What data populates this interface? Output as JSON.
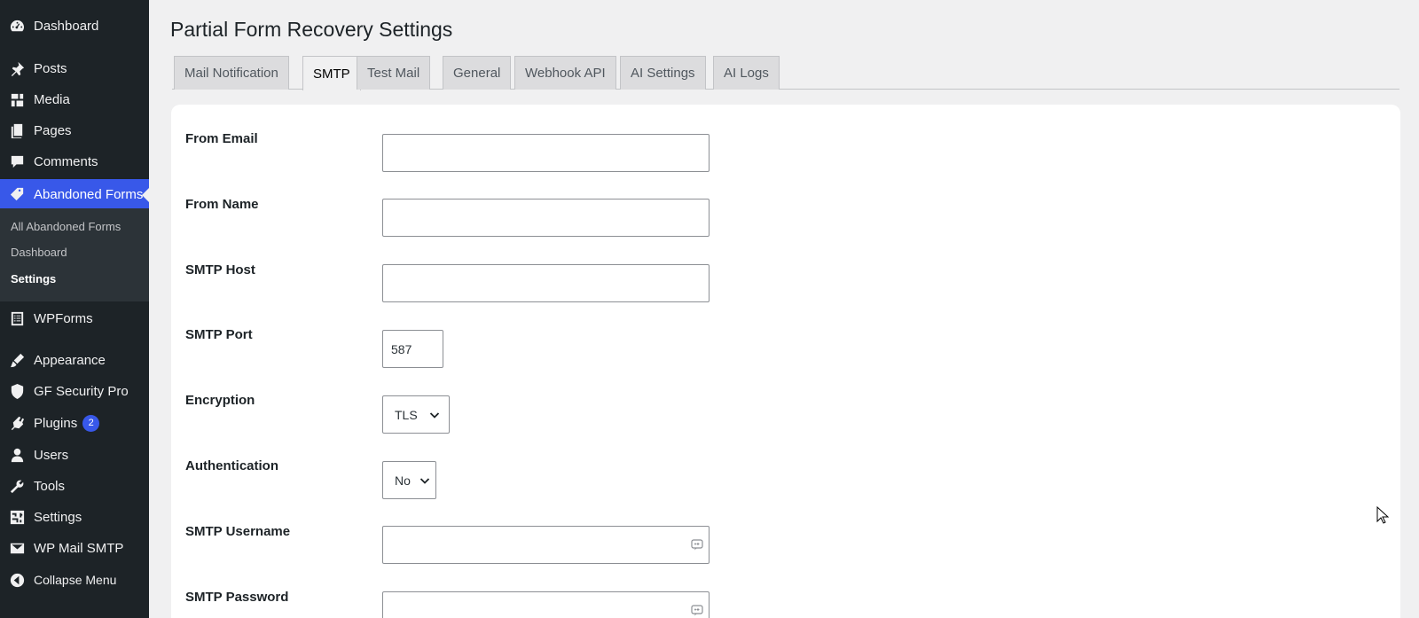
{
  "sidebar": {
    "items": [
      {
        "label": "Dashboard",
        "icon": "dashboard-icon"
      },
      {
        "label": "Posts",
        "icon": "pin-icon"
      },
      {
        "label": "Media",
        "icon": "media-icon"
      },
      {
        "label": "Pages",
        "icon": "pages-icon"
      },
      {
        "label": "Comments",
        "icon": "comment-icon"
      },
      {
        "label": "Abandoned Forms",
        "icon": "tag-icon"
      },
      {
        "label": "WPForms",
        "icon": "forms-icon"
      },
      {
        "label": "Appearance",
        "icon": "brush-icon"
      },
      {
        "label": "GF Security Pro",
        "icon": "shield-icon"
      },
      {
        "label": "Plugins",
        "icon": "plugin-icon",
        "badge": "2"
      },
      {
        "label": "Users",
        "icon": "user-icon"
      },
      {
        "label": "Tools",
        "icon": "wrench-icon"
      },
      {
        "label": "Settings",
        "icon": "settings-icon"
      },
      {
        "label": "WP Mail SMTP",
        "icon": "mail-icon"
      },
      {
        "label": "Collapse Menu",
        "icon": "collapse-icon"
      }
    ],
    "submenu": [
      {
        "label": "All Abandoned Forms"
      },
      {
        "label": "Dashboard"
      },
      {
        "label": "Settings"
      }
    ],
    "active_color": "#3858e9"
  },
  "page": {
    "title": "Partial Form Recovery Settings"
  },
  "tabs": [
    {
      "label": "Mail Notification"
    },
    {
      "label": "SMTP"
    },
    {
      "label": "Test Mail"
    },
    {
      "label": "General"
    },
    {
      "label": "Webhook API"
    },
    {
      "label": "AI Settings"
    },
    {
      "label": "AI Logs"
    }
  ],
  "form": {
    "from_email": {
      "label": "From Email",
      "value": ""
    },
    "from_name": {
      "label": "From Name",
      "value": ""
    },
    "smtp_host": {
      "label": "SMTP Host",
      "value": ""
    },
    "smtp_port": {
      "label": "SMTP Port",
      "value": "587"
    },
    "encryption": {
      "label": "Encryption",
      "value": "TLS"
    },
    "authentication": {
      "label": "Authentication",
      "value": "No"
    },
    "smtp_username": {
      "label": "SMTP Username",
      "value": ""
    },
    "smtp_password": {
      "label": "SMTP Password",
      "value": ""
    }
  }
}
